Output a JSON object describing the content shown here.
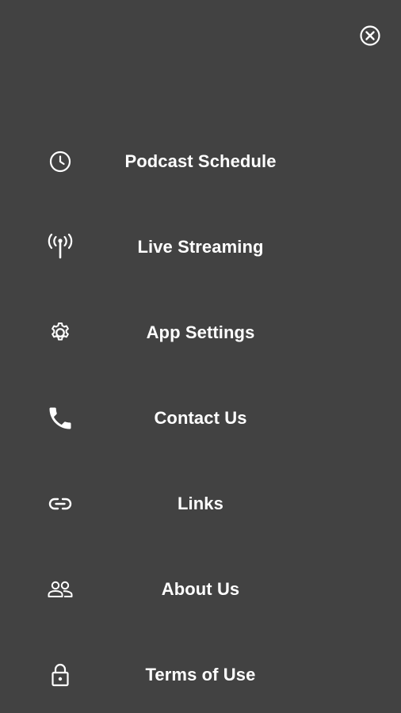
{
  "close": {
    "icon": "close-circle-icon"
  },
  "menu": {
    "items": [
      {
        "label": "Podcast Schedule",
        "icon": "clock-icon"
      },
      {
        "label": "Live Streaming",
        "icon": "antenna-icon"
      },
      {
        "label": "App Settings",
        "icon": "gear-icon"
      },
      {
        "label": "Contact Us",
        "icon": "phone-icon"
      },
      {
        "label": "Links",
        "icon": "link-icon"
      },
      {
        "label": "About Us",
        "icon": "people-icon"
      },
      {
        "label": "Terms of Use",
        "icon": "lock-icon"
      }
    ]
  },
  "colors": {
    "background": "#424242",
    "text": "#ffffff"
  }
}
